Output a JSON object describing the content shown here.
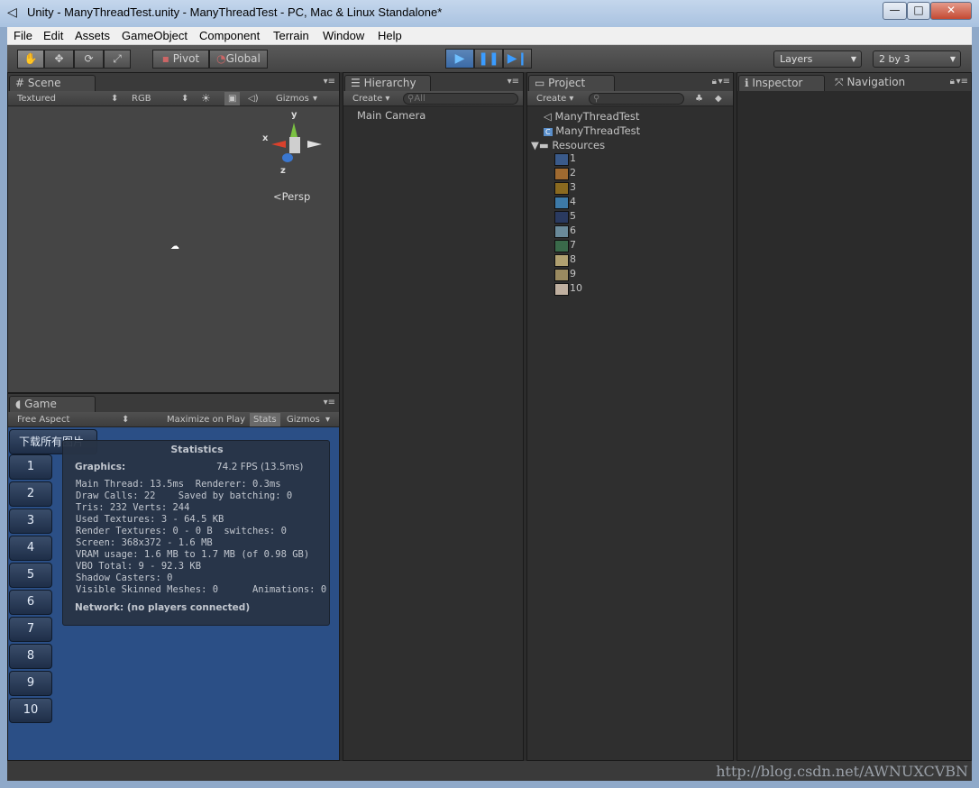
{
  "window": {
    "title": "Unity - ManyThreadTest.unity - ManyThreadTest - PC, Mac & Linux Standalone*",
    "minimize": "—",
    "maximize": "□",
    "close": "✕"
  },
  "menu": [
    "File",
    "Edit",
    "Assets",
    "GameObject",
    "Component",
    "Terrain",
    "Window",
    "Help"
  ],
  "toolbar": {
    "pivot": "Pivot",
    "global": "Global",
    "layers": "Layers",
    "layout": "2 by 3"
  },
  "scene": {
    "tab": "Scene",
    "shading": "Textured",
    "render_mode": "RGB",
    "gizmos": "Gizmos",
    "persp": "Persp",
    "axis_y": "y",
    "axis_x": "x",
    "axis_z": "z"
  },
  "game": {
    "tab": "Game",
    "aspect": "Free Aspect",
    "maximize_on_play": "Maximize on Play",
    "stats": "Stats",
    "gizmos": "Gizmos",
    "download_button": "下载所有图片",
    "buttons": [
      "1",
      "2",
      "3",
      "4",
      "5",
      "6",
      "7",
      "8",
      "9",
      "10"
    ]
  },
  "statistics": {
    "title": "Statistics",
    "graphics_label": "Graphics:",
    "fps": "74.2 FPS (13.5ms)",
    "lines": [
      "Main Thread: 13.5ms  Renderer: 0.3ms",
      "Draw Calls: 22    Saved by batching: 0",
      "Tris: 232 Verts: 244",
      "Used Textures: 3 - 64.5 KB",
      "Render Textures: 0 - 0 B  switches: 0",
      "Screen: 368x372 - 1.6 MB",
      "VRAM usage: 1.6 MB to 1.7 MB (of 0.98 GB)",
      "VBO Total: 9 - 92.3 KB",
      "Shadow Casters: 0",
      "Visible Skinned Meshes: 0      Animations: 0"
    ],
    "network": "Network: (no players connected)"
  },
  "hierarchy": {
    "tab": "Hierarchy",
    "create": "Create",
    "search_placeholder": "All",
    "items": [
      "Main Camera"
    ]
  },
  "project": {
    "tab": "Project",
    "create": "Create",
    "items": [
      "ManyThreadTest",
      "ManyThreadTest"
    ],
    "folder": "Resources",
    "images": [
      "1",
      "2",
      "3",
      "4",
      "5",
      "6",
      "7",
      "8",
      "9",
      "10"
    ],
    "thumb_colors": [
      "#3a5a8a",
      "#a06a30",
      "#8a6a20",
      "#3d7aa8",
      "#2a3a60",
      "#6a8a9a",
      "#3a6a4a",
      "#b0a070",
      "#9a8a60",
      "#c0b0a0"
    ]
  },
  "inspector": {
    "tab": "Inspector",
    "nav_tab": "Navigation"
  },
  "watermark": "http://blog.csdn.net/AWNUXCVBN"
}
